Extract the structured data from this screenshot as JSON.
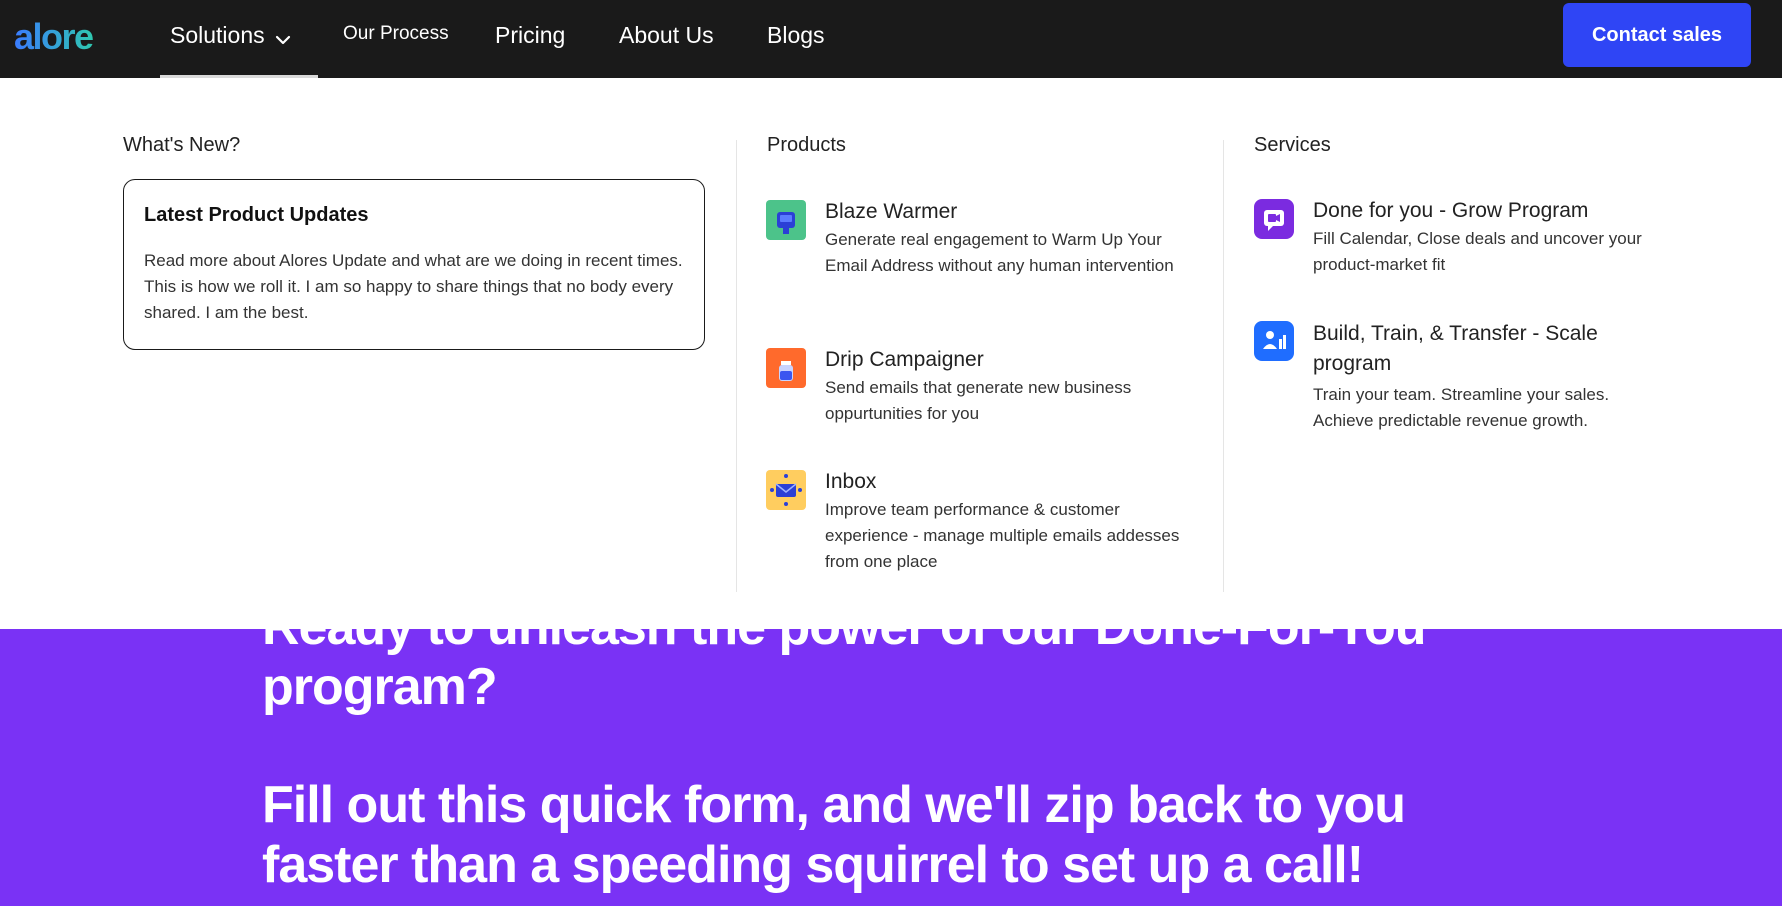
{
  "brand": {
    "logo_text": "alore"
  },
  "nav": {
    "items": [
      {
        "label": "Solutions"
      },
      {
        "label": "Our Process"
      },
      {
        "label": "Pricing"
      },
      {
        "label": "About Us"
      },
      {
        "label": "Blogs"
      }
    ],
    "cta_label": "Contact sales"
  },
  "mega_menu": {
    "whats_new": {
      "heading": "What's New?",
      "card_title": "Latest Product Updates",
      "card_desc": "Read more about Alores Update and what are we doing in recent times. This is how we roll it. I am so happy to share things that no body every shared. I am the best."
    },
    "products": {
      "heading": "Products",
      "items": [
        {
          "title": "Blaze Warmer",
          "desc": "Generate real engagement to Warm Up Your Email Address without any human intervention",
          "icon": "mailbox-icon"
        },
        {
          "title": "Drip Campaigner",
          "desc": "Send emails that generate new business oppurtunities for you",
          "icon": "jar-icon"
        },
        {
          "title": "Inbox",
          "desc": "Improve team performance & customer experience - manage multiple emails addesses from one place",
          "icon": "inbox-icon"
        }
      ]
    },
    "services": {
      "heading": "Services",
      "items": [
        {
          "title": "Done for you - Grow Program",
          "desc": "Fill Calendar, Close deals and uncover your product-market fit",
          "icon": "video-chat-icon"
        },
        {
          "title": "Build, Train, & Transfer - Scale program",
          "desc": "Train your team. Streamline your sales. Achieve predictable revenue growth.",
          "icon": "team-icon"
        }
      ]
    }
  },
  "hero": {
    "line1": "Ready to unleash the power of our Done-For-You",
    "line2": "program?",
    "line3": "Fill out this quick form, and we'll zip back to you",
    "line4": "faster than a speeding squirrel to set up a call!"
  },
  "colors": {
    "navbar_bg": "#1a1a1a",
    "cta_bg": "#2f45f5",
    "hero_bg": "#7a32f5"
  }
}
